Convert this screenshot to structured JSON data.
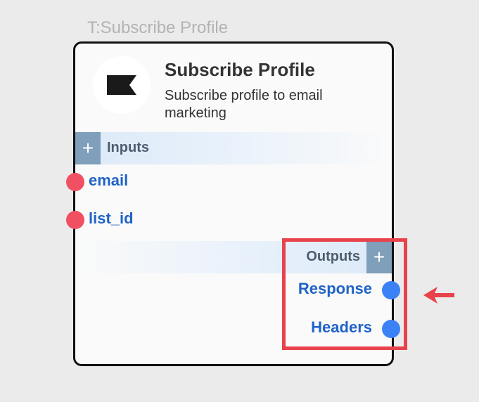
{
  "node_tag": "T:Subscribe Profile",
  "card": {
    "title": "Subscribe Profile",
    "description": "Subscribe profile to email marketing",
    "logo_icon": "flag-icon"
  },
  "inputs": {
    "label": "Inputs",
    "add_label": "+",
    "ports": [
      {
        "label": "email",
        "color": "#f05062"
      },
      {
        "label": "list_id",
        "color": "#f05062"
      }
    ]
  },
  "outputs": {
    "label": "Outputs",
    "add_label": "+",
    "ports": [
      {
        "label": "Response",
        "color": "#3b82f6"
      },
      {
        "label": "Headers",
        "color": "#3b82f6"
      }
    ]
  },
  "annotation": {
    "highlight_color": "#e8424b",
    "arrow_icon": "arrow-left-icon"
  }
}
